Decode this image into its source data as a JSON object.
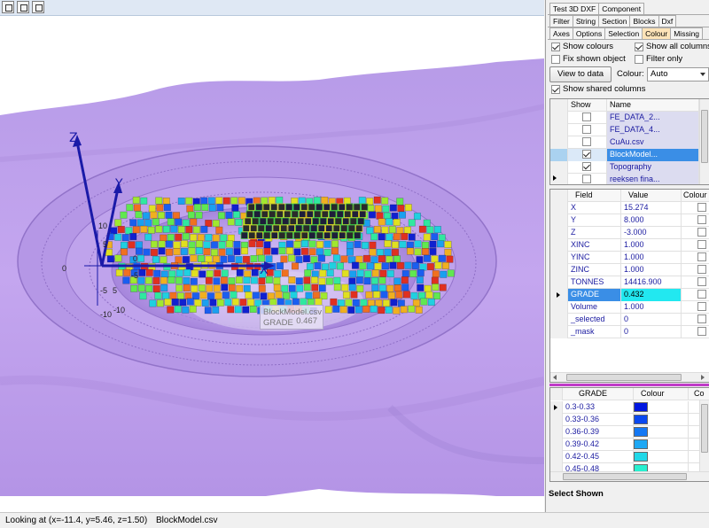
{
  "viewport": {
    "axes": {
      "z": "Z",
      "y": "Y",
      "x": "X"
    },
    "tick_labels": [
      "10",
      "5",
      "0",
      "-5",
      "5",
      "-10",
      "-10",
      "-5",
      "0"
    ],
    "tooltip": {
      "name": "BlockModel.csv",
      "field": "GRADE",
      "value": "0.467"
    }
  },
  "panel": {
    "tabs_row1": [
      "Test 3D DXF",
      "Component"
    ],
    "tabs_row2": [
      "Filter",
      "String",
      "Section",
      "Blocks",
      "Dxf"
    ],
    "tabs_row3": [
      "Axes",
      "Options",
      "Selection",
      "Colour",
      "Missing"
    ],
    "options": {
      "show_colours": "Show colours",
      "show_all_columns": "Show all columns",
      "fix_shown_object": "Fix shown object",
      "filter_only": "Filter only",
      "view_to_data": "View to data",
      "colour_label": "Colour:",
      "colour_value": "Auto",
      "show_shared_columns": "Show shared columns"
    },
    "objects_grid": {
      "headers": [
        "Show",
        "Name"
      ],
      "rows": [
        {
          "name": "FE_DATA_2...",
          "checked": false
        },
        {
          "name": "FE_DATA_4...",
          "checked": false
        },
        {
          "name": "CuAu.csv",
          "checked": false
        },
        {
          "name": "BlockModel...",
          "checked": true
        },
        {
          "name": "Topography",
          "checked": true
        },
        {
          "name": "reeksen fina...",
          "checked": false
        }
      ]
    },
    "fields_grid": {
      "headers": [
        "Field",
        "Value",
        "Colour"
      ],
      "rows": [
        {
          "field": "X",
          "value": "15.274"
        },
        {
          "field": "Y",
          "value": "8.000"
        },
        {
          "field": "Z",
          "value": "-3.000"
        },
        {
          "field": "XINC",
          "value": "1.000"
        },
        {
          "field": "YINC",
          "value": "1.000"
        },
        {
          "field": "ZINC",
          "value": "1.000"
        },
        {
          "field": "TONNES",
          "value": "14416.900"
        },
        {
          "field": "GRADE",
          "value": "0.432"
        },
        {
          "field": "Volume",
          "value": "1.000"
        },
        {
          "field": "_selected",
          "value": "0"
        },
        {
          "field": "_mask",
          "value": "0"
        }
      ]
    },
    "legend_grid": {
      "headers": [
        "GRADE",
        "Colour",
        "Co"
      ],
      "rows": [
        {
          "range": "0.3-0.33",
          "color": "#0016e0"
        },
        {
          "range": "0.33-0.36",
          "color": "#0a48f0"
        },
        {
          "range": "0.36-0.39",
          "color": "#1478f4"
        },
        {
          "range": "0.39-0.42",
          "color": "#1ea8f4"
        },
        {
          "range": "0.42-0.45",
          "color": "#20d8e8"
        },
        {
          "range": "0.45-0.48",
          "color": "#28f0d0"
        }
      ]
    },
    "select_shown": "Select Shown"
  },
  "status": {
    "looking_at": "Looking at (x=-11.4, y=5.46, z=1.50)",
    "file": "BlockModel.csv"
  }
}
